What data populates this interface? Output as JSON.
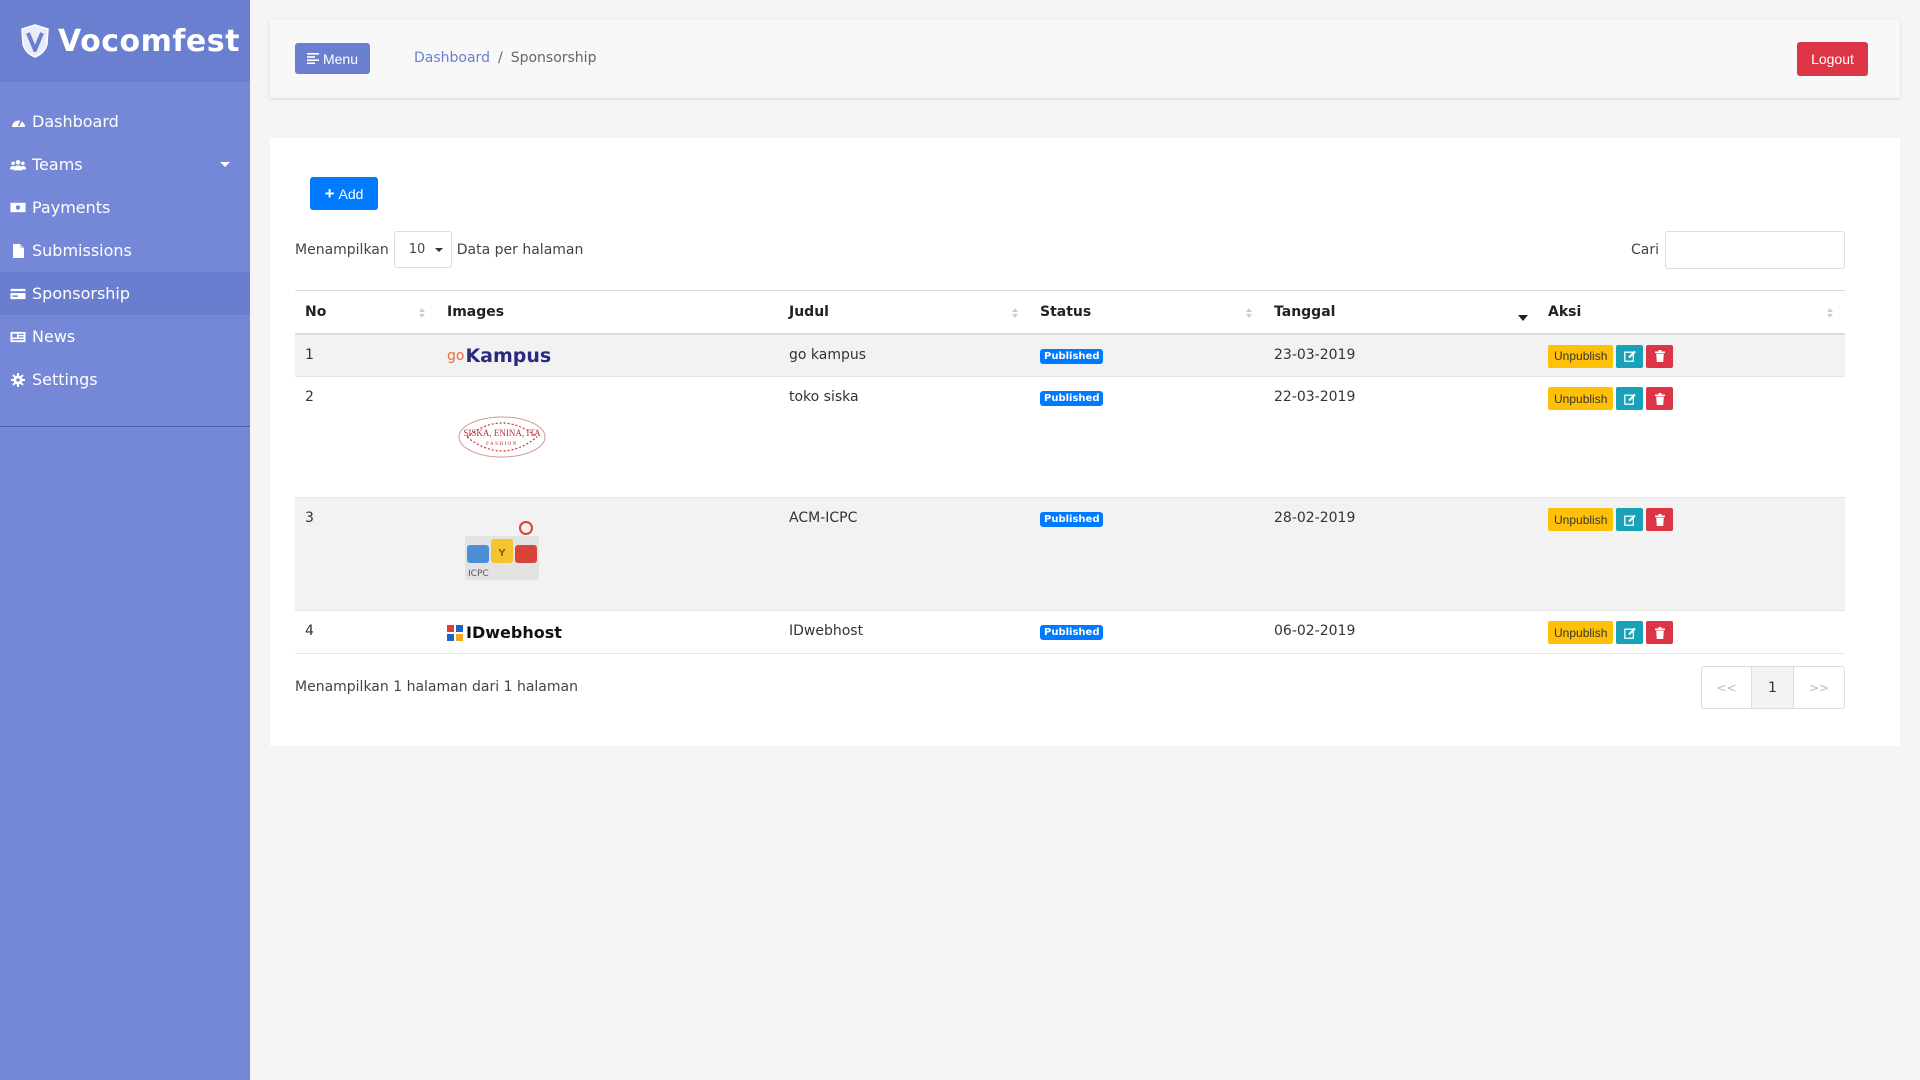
{
  "brand": {
    "name": "Vocomfest"
  },
  "sidebar": {
    "items": [
      {
        "label": "Dashboard",
        "icon": "dashboard-icon"
      },
      {
        "label": "Teams",
        "icon": "users-icon"
      },
      {
        "label": "Payments",
        "icon": "money-icon"
      },
      {
        "label": "Submissions",
        "icon": "file-icon"
      },
      {
        "label": "Sponsorship",
        "icon": "card-icon"
      },
      {
        "label": "News",
        "icon": "newspaper-icon"
      },
      {
        "label": "Settings",
        "icon": "gear-icon"
      }
    ]
  },
  "header": {
    "menu_label": "Menu",
    "breadcrumb": {
      "home": "Dashboard",
      "separator": "/",
      "current": "Sponsorship"
    },
    "logout_label": "Logout"
  },
  "toolbar": {
    "add_label": "Add",
    "length_prefix": "Menampilkan",
    "length_value": "10",
    "length_suffix": "Data per halaman",
    "search_label": "Cari",
    "search_value": ""
  },
  "table": {
    "columns": [
      "No",
      "Images",
      "Judul",
      "Status",
      "Tanggal",
      "Aksi"
    ],
    "rows": [
      {
        "no": "1",
        "image": "gokampus-logo",
        "image_text": {
          "prefix": "go",
          "main": "Kampus"
        },
        "judul": "go kampus",
        "status": "Published",
        "tanggal": "23-03-2019",
        "action_label": "Unpublish"
      },
      {
        "no": "2",
        "image": "siska-enina-ita-fashion-logo",
        "image_text": {
          "main": "SISKA, ENINA, ITA",
          "sub": "FASHION"
        },
        "judul": "toko siska",
        "status": "Published",
        "tanggal": "22-03-2019",
        "action_label": "Unpublish"
      },
      {
        "no": "3",
        "image": "icpc-logo",
        "image_text": {
          "main": "ICPC"
        },
        "judul": "ACM-ICPC",
        "status": "Published",
        "tanggal": "28-02-2019",
        "action_label": "Unpublish"
      },
      {
        "no": "4",
        "image": "idwebhost-logo",
        "image_text": {
          "main": "IDwebhost"
        },
        "judul": "IDwebhost",
        "status": "Published",
        "tanggal": "06-02-2019",
        "action_label": "Unpublish"
      }
    ]
  },
  "footer": {
    "info": "Menampilkan 1 halaman dari 1 halaman",
    "pager": {
      "prev": "<<",
      "current": "1",
      "next": ">>"
    }
  },
  "colors": {
    "sidebar": "#7588d7",
    "primary": "#007bff",
    "danger": "#dc3545",
    "warning": "#ffc107",
    "info": "#17a2b8"
  }
}
